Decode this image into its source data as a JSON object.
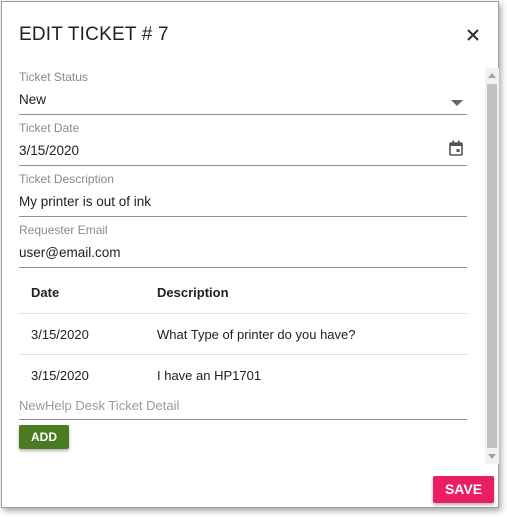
{
  "dialog": {
    "title": "EDIT TICKET # 7",
    "close_icon": "close-icon"
  },
  "form": {
    "status": {
      "label": "Ticket Status",
      "value": "New",
      "icon": "dropdown-arrow-icon"
    },
    "date": {
      "label": "Ticket Date",
      "value": "3/15/2020",
      "icon": "calendar-icon"
    },
    "description": {
      "label": "Ticket Description",
      "value": "My printer is out of ink"
    },
    "email": {
      "label": "Requester Email",
      "value": "user@email.com"
    }
  },
  "details_table": {
    "headers": {
      "date": "Date",
      "description": "Description"
    },
    "rows": [
      {
        "date": "3/15/2020",
        "description": "What Type of printer do you have?"
      },
      {
        "date": "3/15/2020",
        "description": "I have an HP1701"
      }
    ]
  },
  "new_detail": {
    "placeholder": "NewHelp Desk Ticket Detail",
    "add_label": "ADD"
  },
  "footer": {
    "save_label": "SAVE"
  },
  "colors": {
    "add_button": "#4b7b20",
    "save_button": "#e91e63"
  }
}
